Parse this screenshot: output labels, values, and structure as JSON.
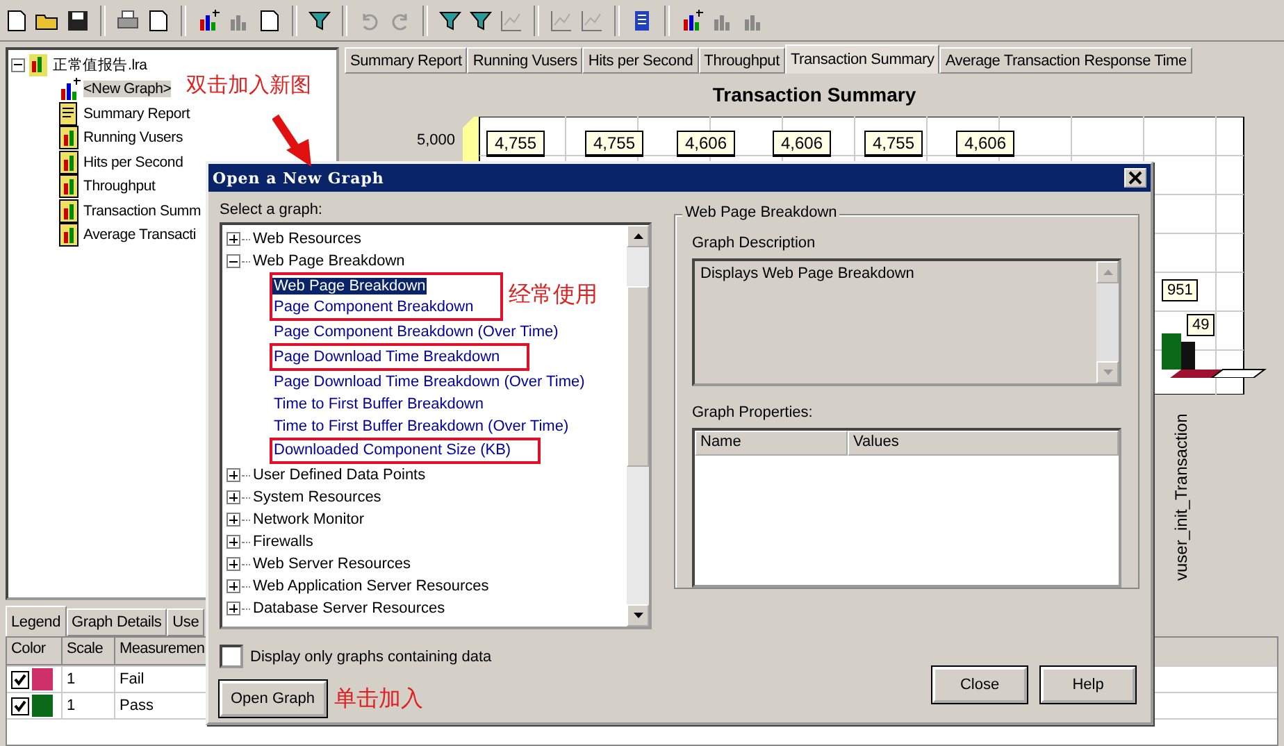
{
  "file_tree": {
    "root": {
      "label": "正常值报告.lra",
      "expanded": true
    },
    "items": [
      {
        "label": "<New Graph>",
        "kind": "new",
        "selected": true
      },
      {
        "label": "Summary Report",
        "kind": "report",
        "selected": false
      },
      {
        "label": "Running Vusers",
        "kind": "graph",
        "selected": false
      },
      {
        "label": "Hits per Second",
        "kind": "graph",
        "selected": false
      },
      {
        "label": "Throughput",
        "kind": "graph",
        "selected": false
      },
      {
        "label": "Transaction Summ",
        "kind": "graph",
        "selected": false
      },
      {
        "label": "Average Transacti",
        "kind": "graph",
        "selected": false
      }
    ]
  },
  "graph_tabs": [
    {
      "label": "Summary Report",
      "selected": false
    },
    {
      "label": "Running Vusers",
      "selected": false
    },
    {
      "label": "Hits per Second",
      "selected": false
    },
    {
      "label": "Throughput",
      "selected": false
    },
    {
      "label": "Transaction Summary",
      "selected": true
    },
    {
      "label": "Average Transaction Response Time",
      "selected": false
    }
  ],
  "chart": {
    "title": "Transaction Summary",
    "y_tick": "5,000",
    "value_labels": [
      "4,755",
      "4,755",
      "4,606",
      "4,606",
      "4,755",
      "4,606"
    ],
    "side_labels": [
      "951",
      "49"
    ],
    "category_label": "vuser_init_Transaction"
  },
  "legend_tabs": [
    {
      "label": "Legend",
      "selected": true
    },
    {
      "label": "Graph Details",
      "selected": false
    },
    {
      "label": "Use",
      "selected": false
    }
  ],
  "legend_table": {
    "columns": [
      "Color",
      "Scale",
      "Measuremen"
    ],
    "rows": [
      {
        "checked": true,
        "color": "#d0306a",
        "scale": "1",
        "measurement": "Fail"
      },
      {
        "checked": true,
        "color": "#0a6a1a",
        "scale": "1",
        "measurement": "Pass"
      }
    ]
  },
  "dialog": {
    "title": "Open a New Graph",
    "select_label": "Select a graph:",
    "tree": [
      {
        "label": "Web Resources",
        "expanded": false
      },
      {
        "label": "Web Page Breakdown",
        "expanded": true,
        "groups": [
          {
            "boxed": true,
            "items": [
              {
                "label": "Web Page Breakdown",
                "selected": true
              },
              {
                "label": "Page Component Breakdown",
                "selected": false
              }
            ]
          },
          {
            "boxed": false,
            "items": [
              {
                "label": "Page Component Breakdown (Over Time)",
                "selected": false
              }
            ]
          },
          {
            "boxed": true,
            "items": [
              {
                "label": "Page Download Time Breakdown",
                "selected": false
              }
            ]
          },
          {
            "boxed": false,
            "items": [
              {
                "label": "Page Download Time Breakdown (Over Time)",
                "selected": false
              },
              {
                "label": "Time to First Buffer Breakdown",
                "selected": false
              },
              {
                "label": "Time to First Buffer Breakdown (Over Time)",
                "selected": false
              }
            ]
          },
          {
            "boxed": true,
            "items": [
              {
                "label": "Downloaded Component Size (KB)",
                "selected": false
              }
            ]
          }
        ]
      },
      {
        "label": "User Defined Data Points",
        "expanded": false
      },
      {
        "label": "System Resources",
        "expanded": false
      },
      {
        "label": "Network Monitor",
        "expanded": false
      },
      {
        "label": "Firewalls",
        "expanded": false
      },
      {
        "label": "Web Server Resources",
        "expanded": false
      },
      {
        "label": "Web Application Server Resources",
        "expanded": false
      },
      {
        "label": "Database Server Resources",
        "expanded": false
      }
    ],
    "group_title": "Web Page Breakdown",
    "description_label": "Graph Description",
    "description": "Displays Web Page Breakdown",
    "properties_label": "Graph Properties:",
    "properties_columns": [
      "Name",
      "Values"
    ],
    "filter_checkbox": {
      "label": "Display only graphs containing data",
      "checked": false
    },
    "buttons": {
      "open": "Open Graph",
      "close": "Close",
      "help": "Help"
    }
  },
  "annotations": {
    "double_click_note": "双击加入新图",
    "frequent_note": "经常使用",
    "click_note": "单击加入"
  }
}
